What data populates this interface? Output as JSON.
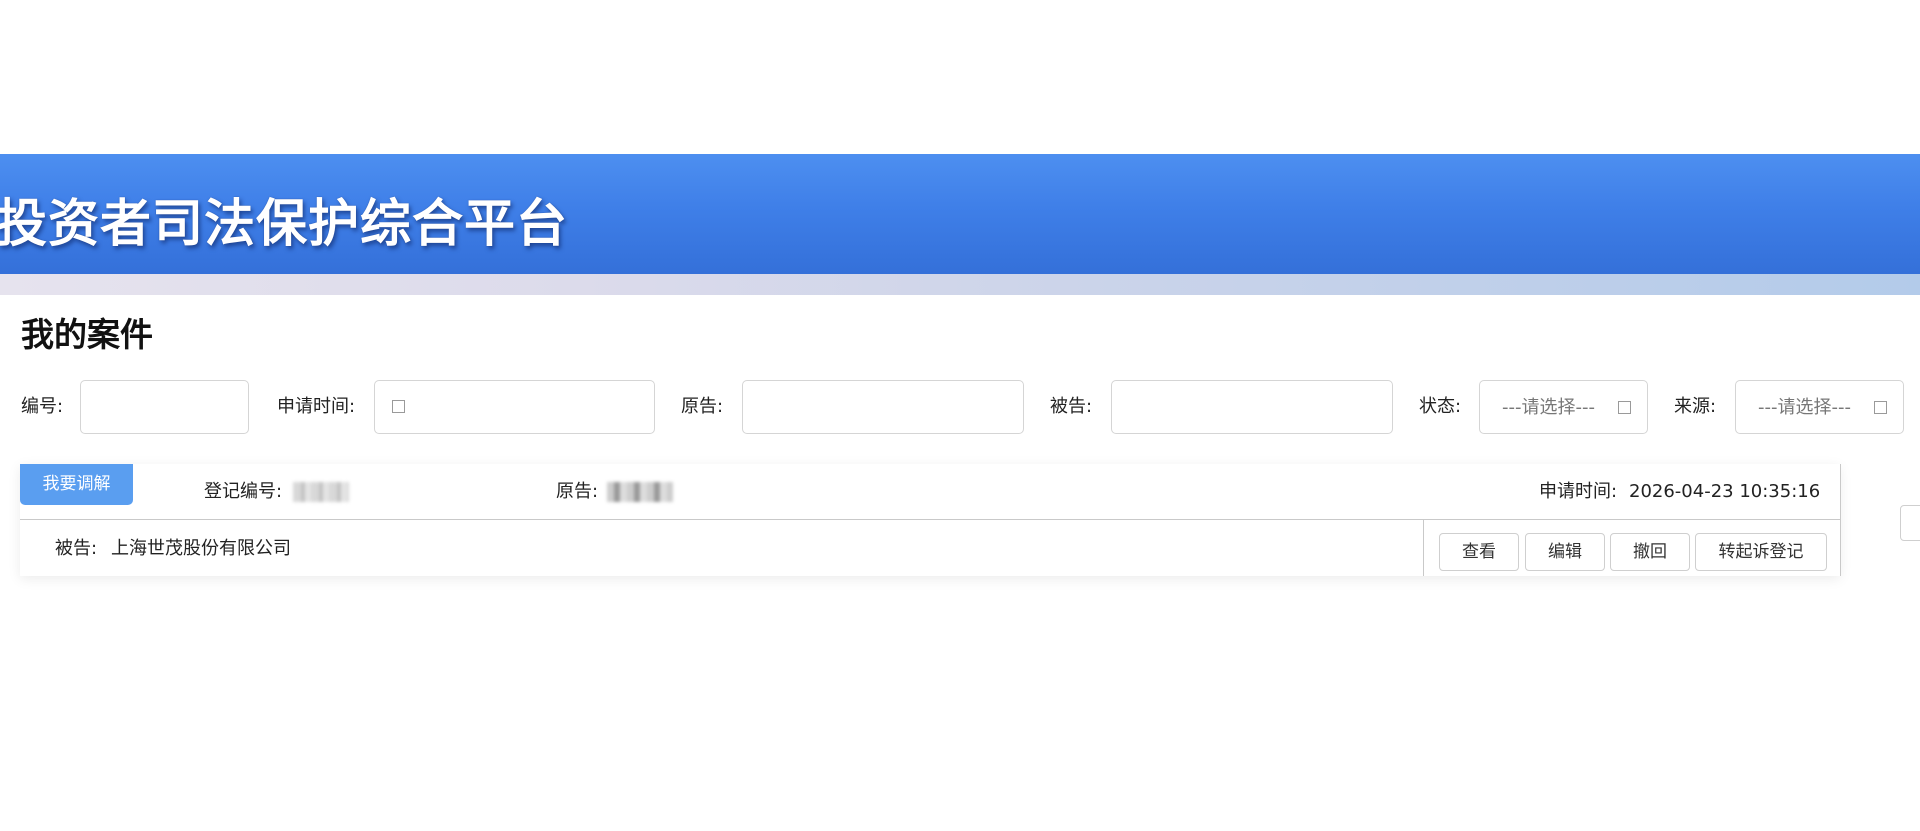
{
  "header": {
    "title": "投资者司法保护综合平台"
  },
  "page": {
    "title": "我的案件"
  },
  "filters": {
    "number_label": "编号:",
    "apply_time_label": "申请时间:",
    "plaintiff_label": "原告:",
    "defendant_label": "被告:",
    "status_label": "状态:",
    "status_value": "---请选择---",
    "source_label": "来源:",
    "source_value": "---请选择---"
  },
  "case_card": {
    "tag_label": "我要调解",
    "reg_no_label": "登记编号:",
    "plaintiff_label": "原告:",
    "apply_time_label": "申请时间:",
    "apply_time_value": "2026-04-23 10:35:16",
    "defendant_label": "被告:",
    "defendant_value": "上海世茂股份有限公司",
    "actions": {
      "view": "查看",
      "edit": "编辑",
      "withdraw": "撤回",
      "transfer": "转起诉登记"
    }
  }
}
